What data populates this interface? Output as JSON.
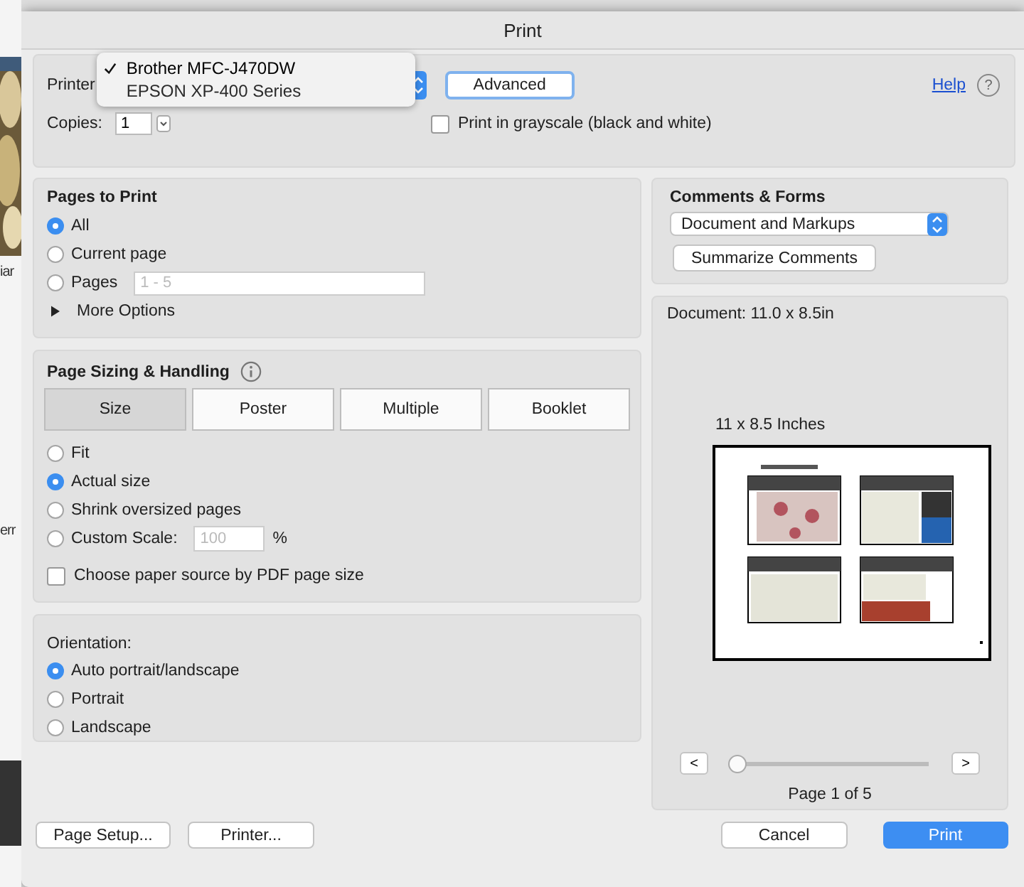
{
  "background": {
    "fragments": [
      "iar",
      "err"
    ]
  },
  "dialog": {
    "title": "Print",
    "printer": {
      "label": "Printer",
      "options": [
        {
          "name": "Brother MFC-J470DW",
          "selected": true
        },
        {
          "name": "EPSON XP-400 Series",
          "selected": false
        }
      ]
    },
    "advanced_button": "Advanced",
    "help_link": "Help",
    "help_icon": "?",
    "copies": {
      "label": "Copies:",
      "value": "1"
    },
    "grayscale": {
      "label": "Print in grayscale (black and white)",
      "checked": false
    },
    "pages_to_print": {
      "title": "Pages to Print",
      "options": [
        {
          "label": "All",
          "selected": true
        },
        {
          "label": "Current page",
          "selected": false
        },
        {
          "label": "Pages",
          "selected": false,
          "placeholder": "1 - 5"
        }
      ],
      "more_options": "More Options"
    },
    "page_sizing": {
      "title": "Page Sizing & Handling",
      "tabs": [
        {
          "label": "Size",
          "selected": true
        },
        {
          "label": "Poster",
          "selected": false
        },
        {
          "label": "Multiple",
          "selected": false
        },
        {
          "label": "Booklet",
          "selected": false
        }
      ],
      "options": [
        {
          "label": "Fit",
          "selected": false
        },
        {
          "label": "Actual size",
          "selected": true
        },
        {
          "label": "Shrink oversized pages",
          "selected": false
        },
        {
          "label": "Custom Scale:",
          "selected": false,
          "placeholder": "100",
          "unit": "%"
        }
      ],
      "paper_source": {
        "label": "Choose paper source by PDF page size",
        "checked": false
      }
    },
    "orientation": {
      "title": "Orientation:",
      "options": [
        {
          "label": "Auto portrait/landscape",
          "selected": true
        },
        {
          "label": "Portrait",
          "selected": false
        },
        {
          "label": "Landscape",
          "selected": false
        }
      ]
    },
    "comments_forms": {
      "title": "Comments & Forms",
      "select": "Document and Markups",
      "summarize_button": "Summarize Comments"
    },
    "preview": {
      "document_size": "Document: 11.0 x 8.5in",
      "paper_label": "11 x 8.5 Inches",
      "prev": "<",
      "next": ">",
      "level": 0,
      "page_label": "Page 1 of 5"
    },
    "buttons": {
      "page_setup": "Page Setup...",
      "printer": "Printer...",
      "cancel": "Cancel",
      "print": "Print"
    }
  }
}
